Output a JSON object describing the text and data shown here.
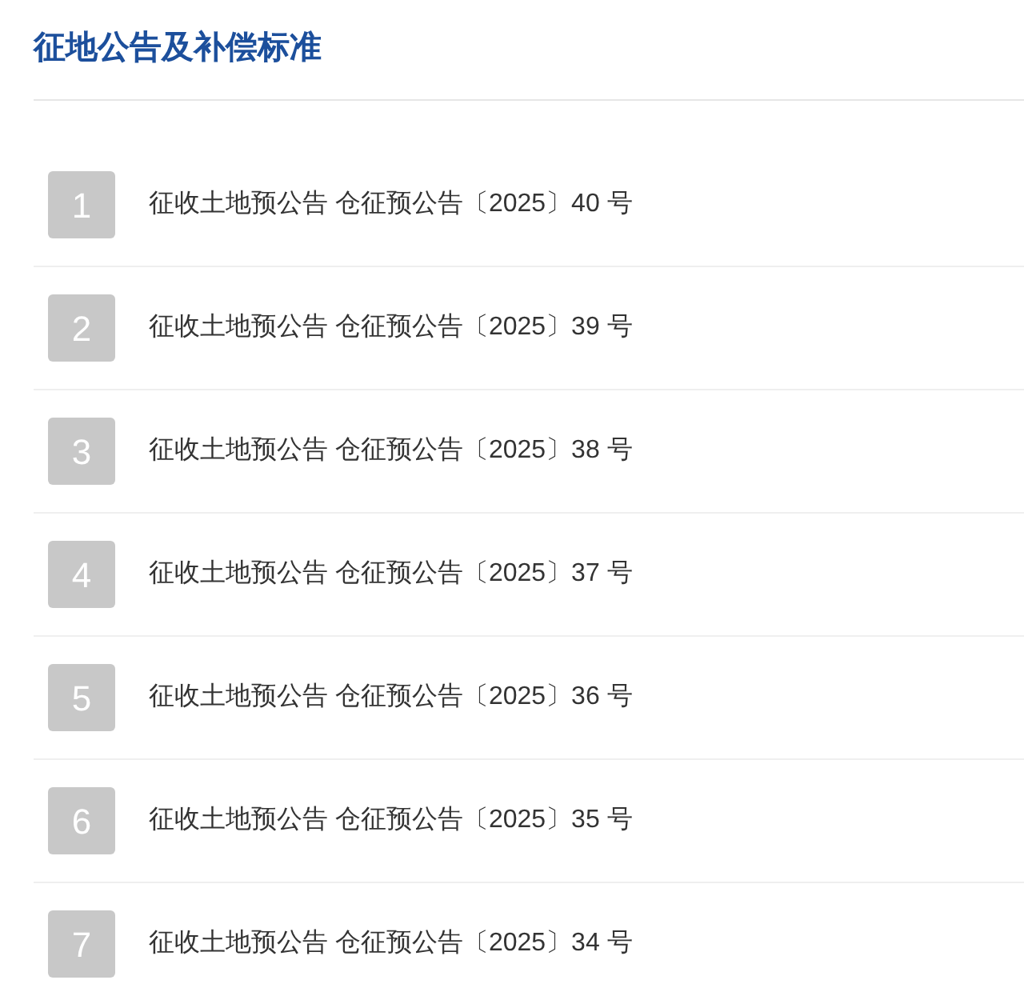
{
  "title": "征地公告及补偿标准",
  "items": [
    {
      "number": "1",
      "text": "征收土地预公告 仓征预公告〔2025〕40 号"
    },
    {
      "number": "2",
      "text": "征收土地预公告 仓征预公告〔2025〕39 号"
    },
    {
      "number": "3",
      "text": "征收土地预公告 仓征预公告〔2025〕38 号"
    },
    {
      "number": "4",
      "text": "征收土地预公告 仓征预公告〔2025〕37 号"
    },
    {
      "number": "5",
      "text": "征收土地预公告 仓征预公告〔2025〕36 号"
    },
    {
      "number": "6",
      "text": "征收土地预公告 仓征预公告〔2025〕35 号"
    },
    {
      "number": "7",
      "text": "征收土地预公告 仓征预公告〔2025〕34 号"
    }
  ]
}
